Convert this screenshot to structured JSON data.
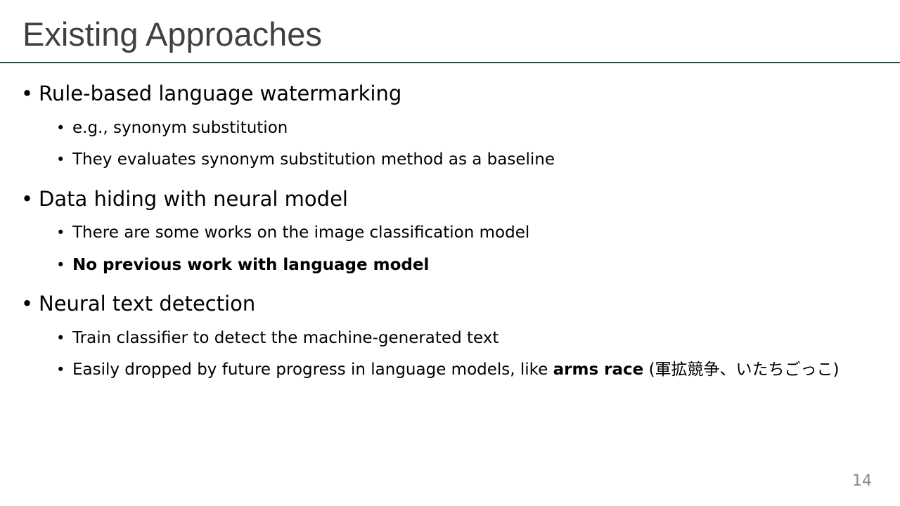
{
  "slide": {
    "title": "Existing Approaches",
    "page_number": "14"
  },
  "bullets": [
    {
      "text": "Rule-based language watermarking",
      "sub": [
        {
          "text": "e.g., synonym substitution"
        },
        {
          "text": "They evaluates synonym substitution method as a baseline"
        }
      ]
    },
    {
      "text": "Data hiding with neural model",
      "sub": [
        {
          "text": "There are some works on the image classification model"
        },
        {
          "text": "No previous work with language model",
          "bold": true
        }
      ]
    },
    {
      "text": "Neural text detection",
      "sub": [
        {
          "text": "Train classifier to detect the machine-generated text"
        },
        {
          "pre": "Easily dropped by future progress in language models, like ",
          "bold_part": "arms race",
          "post": " (軍拡競争、いたちごっこ)"
        }
      ]
    }
  ],
  "bullet_glyph": "•"
}
